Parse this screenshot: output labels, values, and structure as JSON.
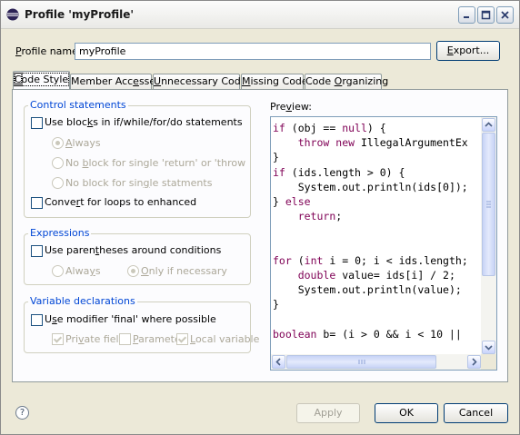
{
  "window": {
    "title": "Profile 'myProfile'",
    "icon": "eclipse-icon",
    "controls": [
      "minimize-icon",
      "maximize-icon",
      "close-icon"
    ]
  },
  "profile": {
    "name_label_pre": "",
    "name_label_mn": "P",
    "name_label_post": "rofile name:",
    "name_value": "myProfile",
    "export_label_pre": "",
    "export_label_mn": "E",
    "export_label_post": "xport..."
  },
  "tabs": [
    {
      "pre": "",
      "mn": "C",
      "post": "ode Style"
    },
    {
      "pre": "Member Acc",
      "mn": "e",
      "post": "sses"
    },
    {
      "pre": "",
      "mn": "U",
      "post": "nnecessary Code"
    },
    {
      "pre": "",
      "mn": "M",
      "post": "issing Code"
    },
    {
      "pre": "Code ",
      "mn": "O",
      "post": "rganizing"
    }
  ],
  "control_statements": {
    "title": "Control statements",
    "use_blocks": {
      "pre": "Use bloc",
      "mn": "k",
      "post": "s in if/while/for/do statements",
      "checked": false
    },
    "always": {
      "pre": "",
      "mn": "A",
      "post": "lways",
      "checked": true
    },
    "no_block_return": {
      "pre": "No ",
      "mn": "b",
      "post": "lock for single 'return' or 'throw' stateme",
      "checked": false
    },
    "no_block_single": {
      "pre": "No block for sin",
      "mn": "g",
      "post": "le statments",
      "checked": false
    },
    "convert_loops": {
      "pre": "Conve",
      "mn": "r",
      "post": "t for loops to enhanced",
      "checked": false
    }
  },
  "expressions": {
    "title": "Expressions",
    "use_parentheses": {
      "pre": "Use paren",
      "mn": "t",
      "post": "heses around conditions",
      "checked": false
    },
    "always": {
      "pre": "Alwa",
      "mn": "y",
      "post": "s",
      "checked": false
    },
    "only_if_necessary": {
      "pre": "",
      "mn": "O",
      "post": "nly if necessary",
      "checked": true
    }
  },
  "variable_declarations": {
    "title": "Variable declarations",
    "use_final": {
      "pre": "U",
      "mn": "s",
      "post": "e modifier 'final' where possible",
      "checked": false
    },
    "private_field": {
      "pre": "Pri",
      "mn": "v",
      "post": "ate field",
      "checked": true
    },
    "parameter": {
      "pre": "",
      "mn": "P",
      "post": "aramete",
      "checked": false
    },
    "local_variable": {
      "pre": "",
      "mn": "L",
      "post": "ocal variable",
      "checked": true
    }
  },
  "preview": {
    "label_pre": "Pre",
    "label_mn": "v",
    "label_post": "iew:",
    "lines": [
      "if (obj == null) {",
      "    throw new IllegalArgumentEx",
      "}",
      "if (ids.length > 0) {",
      "    System.out.println(ids[0]);",
      "} else",
      "    return;",
      "",
      "",
      "for (int i = 0; i < ids.length;",
      "    double value= ids[i] / 2;",
      "    System.out.println(value);",
      "}",
      "",
      "boolean b= (i > 0 && i < 10 ||"
    ],
    "keywords": [
      "if",
      "null",
      "throw",
      "new",
      "else",
      "return",
      "for",
      "int",
      "double",
      "boolean"
    ],
    "keyword_color": "#7f0055"
  },
  "footer": {
    "help_icon": "help-icon",
    "help_glyph": "?",
    "apply_label": "Apply",
    "ok_label": "OK",
    "cancel_label": "Cancel"
  },
  "colors": {
    "group_title": "#0046d5",
    "window_bg": "#ece9d8"
  }
}
